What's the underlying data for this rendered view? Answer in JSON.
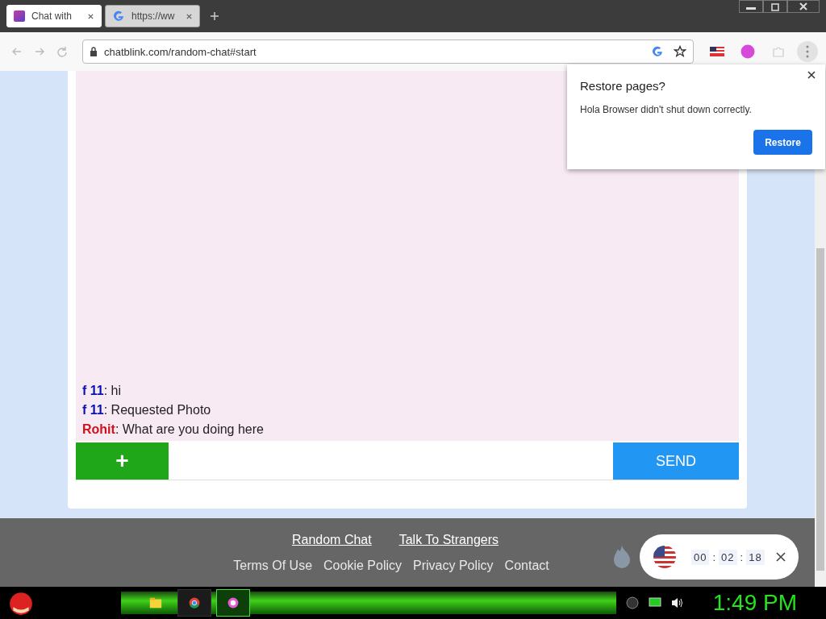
{
  "browser": {
    "tabs": [
      {
        "title": "Chat with",
        "selected": true,
        "kind": "site"
      },
      {
        "title": "https://ww",
        "selected": false,
        "kind": "google"
      }
    ],
    "address": "chatblink.com/random-chat#start"
  },
  "chat": {
    "messages": [
      {
        "sender": "f 11",
        "text": ": hi",
        "color": "#0a10b0"
      },
      {
        "sender": "f 11",
        "text": ": Requested Photo",
        "color": "#0a10b0"
      },
      {
        "sender": "Rohit",
        "text": ": What are you doing here",
        "color": "#d0101a"
      }
    ],
    "add_button": "+",
    "send_button": "SEND"
  },
  "footer": {
    "top_links": [
      "Random Chat",
      "Talk To Strangers"
    ],
    "bottom_links": [
      "Terms Of Use",
      "Cookie Policy",
      "Privacy Policy",
      "Contact"
    ]
  },
  "restore_popup": {
    "title": "Restore pages?",
    "message": "Hola Browser didn't shut down correctly.",
    "button": "Restore"
  },
  "timer": {
    "hours": "00",
    "minutes": "02",
    "seconds": "18",
    "separator": ":"
  },
  "taskbar": {
    "clock": "1:49 PM"
  }
}
